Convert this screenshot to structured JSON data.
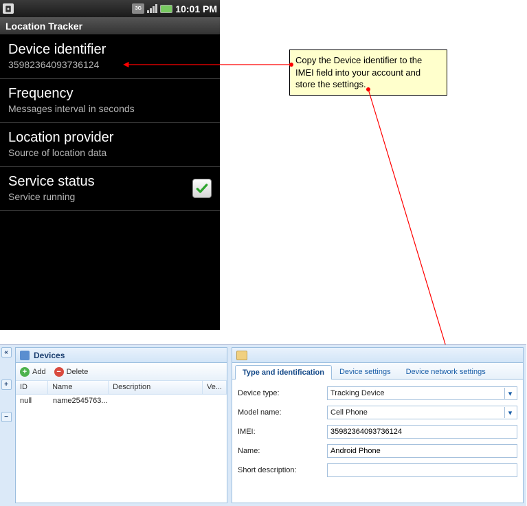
{
  "status": {
    "clock": "10:01 PM",
    "network_label": "3G"
  },
  "app": {
    "title": "Location Tracker"
  },
  "settings": [
    {
      "title": "Device identifier",
      "subtitle": "35982364093736124"
    },
    {
      "title": "Frequency",
      "subtitle": "Messages interval in seconds"
    },
    {
      "title": "Location provider",
      "subtitle": "Source of location data"
    },
    {
      "title": "Service status",
      "subtitle": "Service running"
    }
  ],
  "callout": {
    "text": "Copy the Device identifier to the IMEI field into your account and store the settings."
  },
  "devices": {
    "title": "Devices",
    "add_label": "Add",
    "delete_label": "Delete",
    "columns": {
      "id": "ID",
      "name": "Name",
      "description": "Description",
      "ve": "Ve..."
    },
    "rows": [
      {
        "id": "null",
        "name": "name2545763...",
        "description": "",
        "ve": ""
      }
    ]
  },
  "form": {
    "tabs": {
      "type_id": "Type and identification",
      "device_settings": "Device settings",
      "network": "Device network settings"
    },
    "labels": {
      "device_type": "Device type:",
      "model_name": "Model name:",
      "imei": "IMEI:",
      "name": "Name:",
      "short_desc": "Short description:"
    },
    "values": {
      "device_type": "Tracking Device",
      "model_name": "Cell Phone",
      "imei": "35982364093736124",
      "name": "Android Phone",
      "short_desc": ""
    }
  }
}
